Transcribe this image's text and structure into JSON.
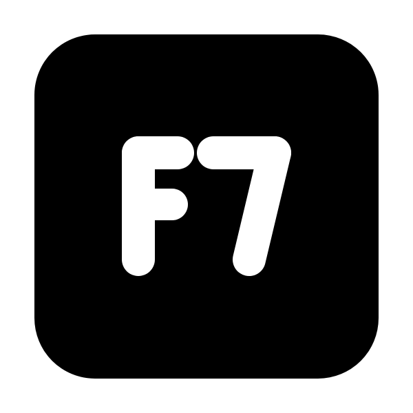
{
  "icon": {
    "name": "f7-key-icon",
    "label": "F7",
    "background_color": "#000000",
    "foreground_color": "#ffffff",
    "canvas_color": "#ffffff"
  }
}
